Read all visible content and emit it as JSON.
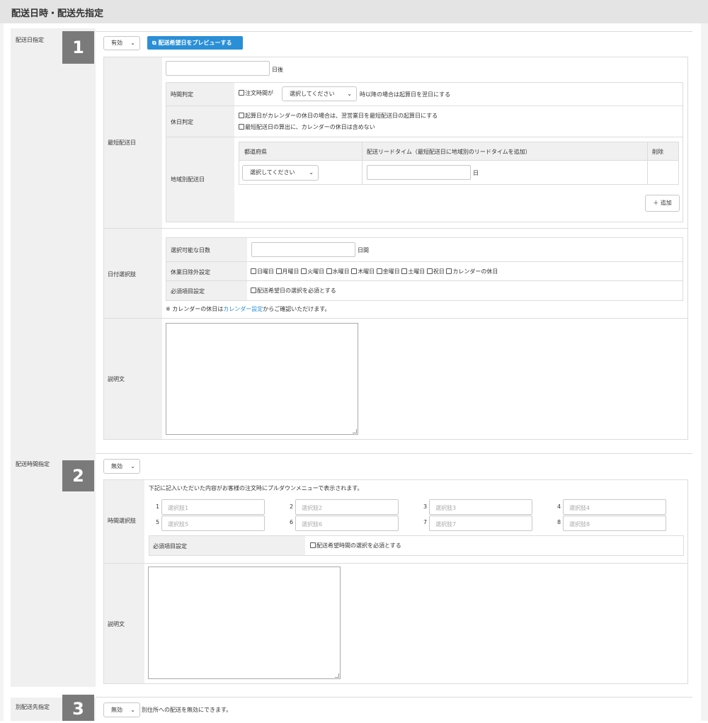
{
  "header": {
    "title": "配送日時・配送先指定"
  },
  "section1": {
    "label": "配送日指定",
    "number": "1",
    "status_select": "有効",
    "preview_button": "配送希望日をプレビューする",
    "shortest": {
      "label": "最短配送日",
      "days_suffix": "日後",
      "time_judge": {
        "label": "時間判定",
        "prefix": "注文時間が",
        "select": "選択してください",
        "suffix": "時以降の場合は起算日を翌日にする"
      },
      "holiday_judge": {
        "label": "休日判定",
        "option1": "起算日がカレンダーの休日の場合は、翌営業日を最短配送日の起算日にする",
        "option2": "最短配送日の算出に、カレンダーの休日は含めない"
      },
      "regional": {
        "label": "地域別配送日",
        "col_pref": "都道府県",
        "col_lead": "配送リードタイム（最短配送日に地域別のリードタイムを追加）",
        "col_delete": "削除",
        "pref_select": "選択してください",
        "lead_suffix": "日",
        "add_button": "＋ 追加"
      }
    },
    "date_choice": {
      "label": "日付選択肢",
      "selectable_days": {
        "label": "選択可能な日数",
        "suffix": "日間"
      },
      "holiday_exclude": {
        "label": "休業日除外設定",
        "days": [
          "日曜日",
          "月曜日",
          "火曜日",
          "水曜日",
          "木曜日",
          "金曜日",
          "土曜日",
          "祝日",
          "カレンダーの休日"
        ]
      },
      "required": {
        "label": "必須項目設定",
        "option": "配送希望日の選択を必須とする"
      },
      "note_prefix": "※ カレンダーの休日は",
      "note_link": "カレンダー設定",
      "note_suffix": "からご確認いただけます。"
    },
    "description": {
      "label": "説明文"
    }
  },
  "section2": {
    "label": "配送時間指定",
    "number": "2",
    "status_select": "無効",
    "time_choice": {
      "label": "時間選択肢",
      "intro": "下記に記入いただいた内容がお客様の注文時にプルダウンメニューで表示されます。",
      "options": [
        {
          "num": "1",
          "placeholder": "選択肢1"
        },
        {
          "num": "2",
          "placeholder": "選択肢2"
        },
        {
          "num": "3",
          "placeholder": "選択肢3"
        },
        {
          "num": "4",
          "placeholder": "選択肢4"
        },
        {
          "num": "5",
          "placeholder": "選択肢5"
        },
        {
          "num": "6",
          "placeholder": "選択肢6"
        },
        {
          "num": "7",
          "placeholder": "選択肢7"
        },
        {
          "num": "8",
          "placeholder": "選択肢8"
        }
      ],
      "required_label": "必須項目設定",
      "required_option": "配送希望時間の選択を必須とする"
    },
    "description": {
      "label": "説明文"
    }
  },
  "section3": {
    "label": "別配送先指定",
    "number": "3",
    "status_select": "無効",
    "note": "別住所への配送を無効にできます。"
  }
}
